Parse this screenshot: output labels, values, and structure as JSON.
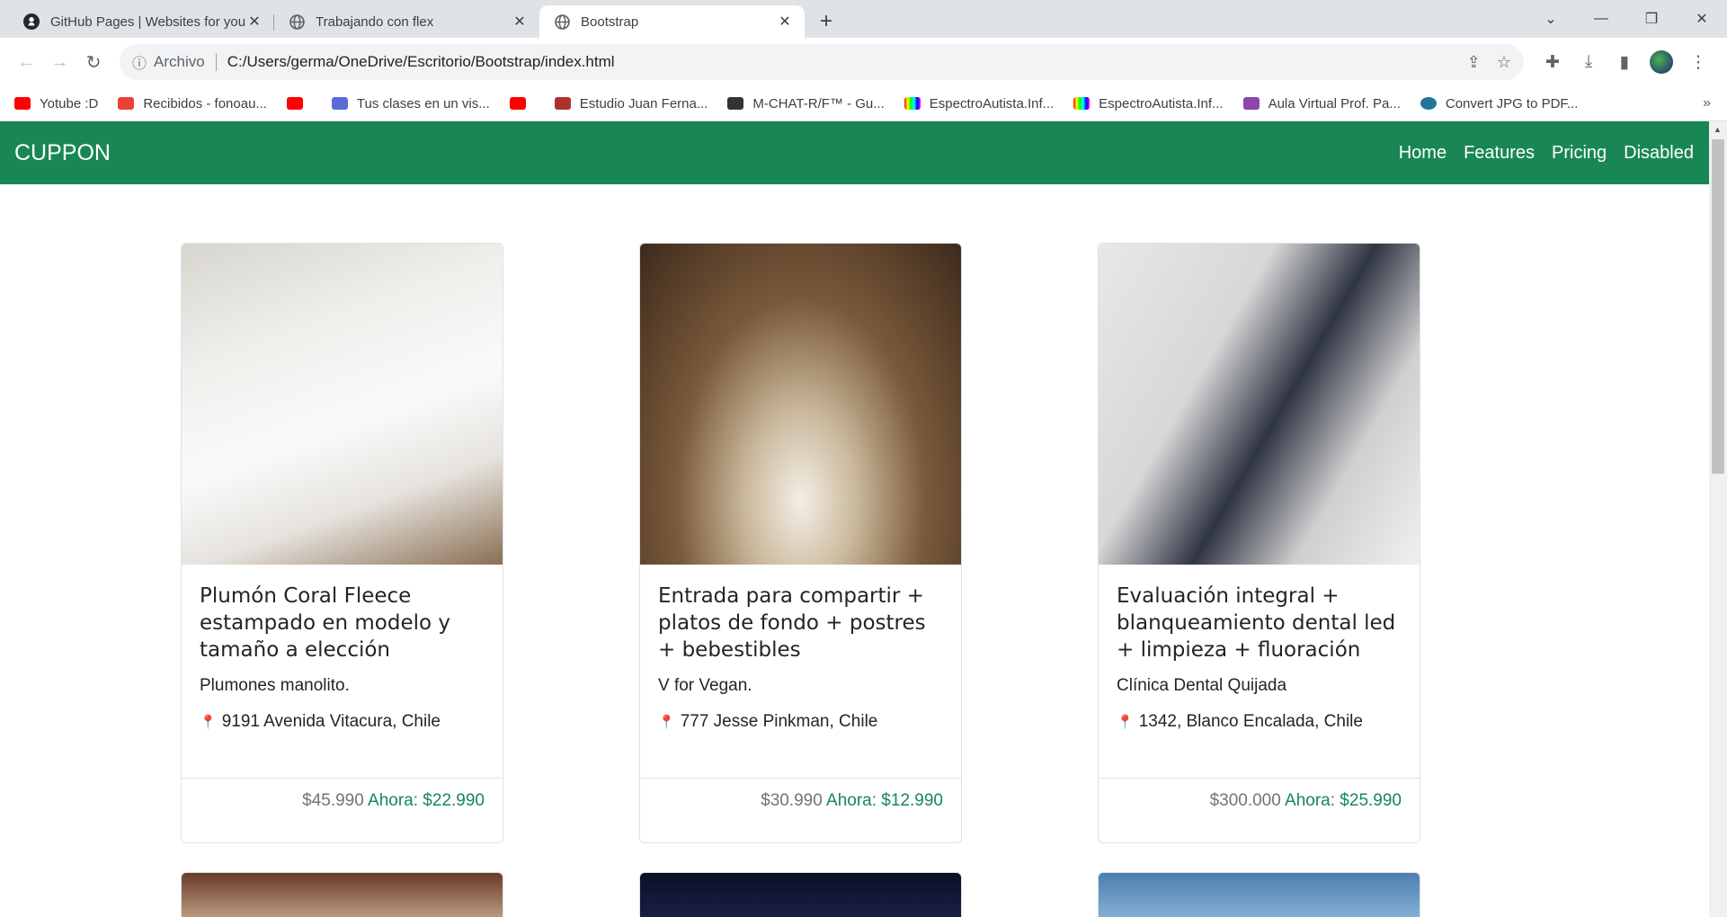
{
  "browser": {
    "tabs": [
      {
        "title": "GitHub Pages | Websites for you",
        "icon": "github-icon"
      },
      {
        "title": "Trabajando con flex",
        "icon": "globe-icon"
      },
      {
        "title": "Bootstrap",
        "icon": "globe-icon"
      }
    ],
    "address": {
      "scheme": "Archivo",
      "url": "C:/Users/germa/OneDrive/Escritorio/Bootstrap/index.html"
    },
    "bookmarks": [
      {
        "label": "Yotube :D",
        "color": "#ff0000"
      },
      {
        "label": "Recibidos - fonoau...",
        "color": "#ea4335"
      },
      {
        "label": "",
        "color": "#ff0000"
      },
      {
        "label": "Tus clases en un vis...",
        "color": "#5b6bd8"
      },
      {
        "label": "",
        "color": "#ff0000"
      },
      {
        "label": "Estudio Juan Ferna...",
        "color": "#b03030"
      },
      {
        "label": "M-CHAT-R/F™ - Gu...",
        "color": "#333333"
      },
      {
        "label": "EspectroAutista.Inf...",
        "color": "#7cb342"
      },
      {
        "label": "EspectroAutista.Inf...",
        "color": "#7cb342"
      },
      {
        "label": "Aula Virtual Prof. Pa...",
        "color": "#8e44ad"
      },
      {
        "label": "Convert JPG to PDF...",
        "color": "#21759b"
      }
    ]
  },
  "navbar": {
    "brand": "CUPPON",
    "links": [
      "Home",
      "Features",
      "Pricing",
      "Disabled"
    ],
    "color": "#198754"
  },
  "cards": [
    {
      "title": "Plumón Coral Fleece estampado en modelo y tamaño a elección",
      "subtitle": "Plumones manolito.",
      "address": "9191 Avenida Vitacura, Chile",
      "old_price": "$45.990",
      "new_price": "Ahora: $22.990"
    },
    {
      "title": "Entrada para compartir + platos de fondo + postres + bebestibles",
      "subtitle": "V for Vegan.",
      "address": "777 Jesse Pinkman, Chile",
      "old_price": "$30.990",
      "new_price": "Ahora: $12.990"
    },
    {
      "title": "Evaluación integral + blanqueamiento dental led + limpieza + fluoración",
      "subtitle": "Clínica Dental Quijada",
      "address": "1342, Blanco Encalada, Chile",
      "old_price": "$300.000",
      "new_price": "Ahora: $25.990"
    }
  ]
}
